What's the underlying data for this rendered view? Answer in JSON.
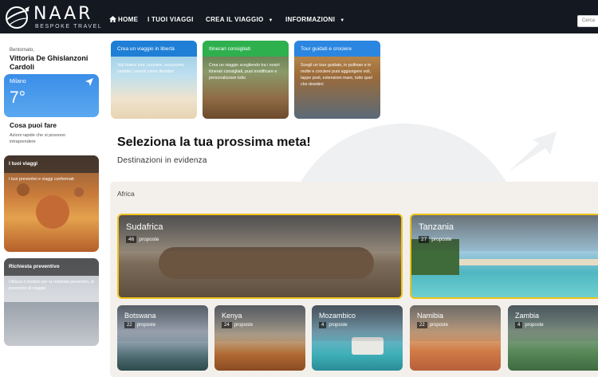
{
  "nav": {
    "brand": "NAAR",
    "tagline": "BESPOKE TRAVEL",
    "items": [
      {
        "label": "HOME"
      },
      {
        "label": "I TUOI VIAGGI"
      },
      {
        "label": "CREA IL VIAGGIO",
        "caret": "▼"
      },
      {
        "label": "INFORMAZIONI",
        "caret": "▼"
      }
    ],
    "search_placeholder": "Cerca"
  },
  "sidebar": {
    "welcome": "Bentornato,",
    "user_name": "Vittoria De Ghislanzoni Cardoli",
    "weather": {
      "city": "Milano",
      "temperature": "7°",
      "icon": "location-arrow-icon"
    },
    "cosa_title": "Cosa puoi fare",
    "cosa_subtitle": "Azioni rapide che si possono intraprendere",
    "cards": [
      {
        "title": "I tuoi viaggi",
        "subtitle": "I tuoi preventivi e viaggi confermati"
      },
      {
        "title": "Richiesta preventivo",
        "subtitle": "Utilizza il modulo per la richiesta preventivi, di preventivi di viaggio"
      }
    ]
  },
  "options": [
    {
      "title": "Crea un viaggio in libertà",
      "description": "Voli hotels tour, crociere, escursioni, cambia i servizi come desideri",
      "color": "#1f7fd6"
    },
    {
      "title": "Itinerari consigliati",
      "description": "Crea un viaggio scegliendo tra i nostri itinerari consigliati, puoi modificare e personalizzare tutto",
      "color": "#2fb04e"
    },
    {
      "title": "Tour guidati e crociere",
      "description": "Scegli un tour guidato, in pullman e in molte e crociere puoi aggiungere voli, tappe post, estensioni mare, tutto quel che desideri",
      "color": "#2a86e0"
    }
  ],
  "hero": {
    "title": "Seleziona la tua prossima meta!",
    "subtitle": "Destinazioni in evidenza"
  },
  "region": {
    "name": "Africa",
    "destinations": [
      {
        "name": "Sudafrica",
        "count": "46",
        "unit": "proposte"
      },
      {
        "name": "Tanzania",
        "count": "27",
        "unit": "proposte"
      },
      {
        "name": "Botswana",
        "count": "22",
        "unit": "proposte"
      },
      {
        "name": "Kenya",
        "count": "24",
        "unit": "proposte"
      },
      {
        "name": "Mozambico",
        "count": "4",
        "unit": "proposte"
      },
      {
        "name": "Namibia",
        "count": "22",
        "unit": "proposte"
      },
      {
        "name": "Zambia",
        "count": "4",
        "unit": "proposte"
      }
    ]
  },
  "colors": {
    "nav_bg": "#141821",
    "highlight_border": "#f0c21a",
    "panel_bg": "#f3f0ec"
  }
}
